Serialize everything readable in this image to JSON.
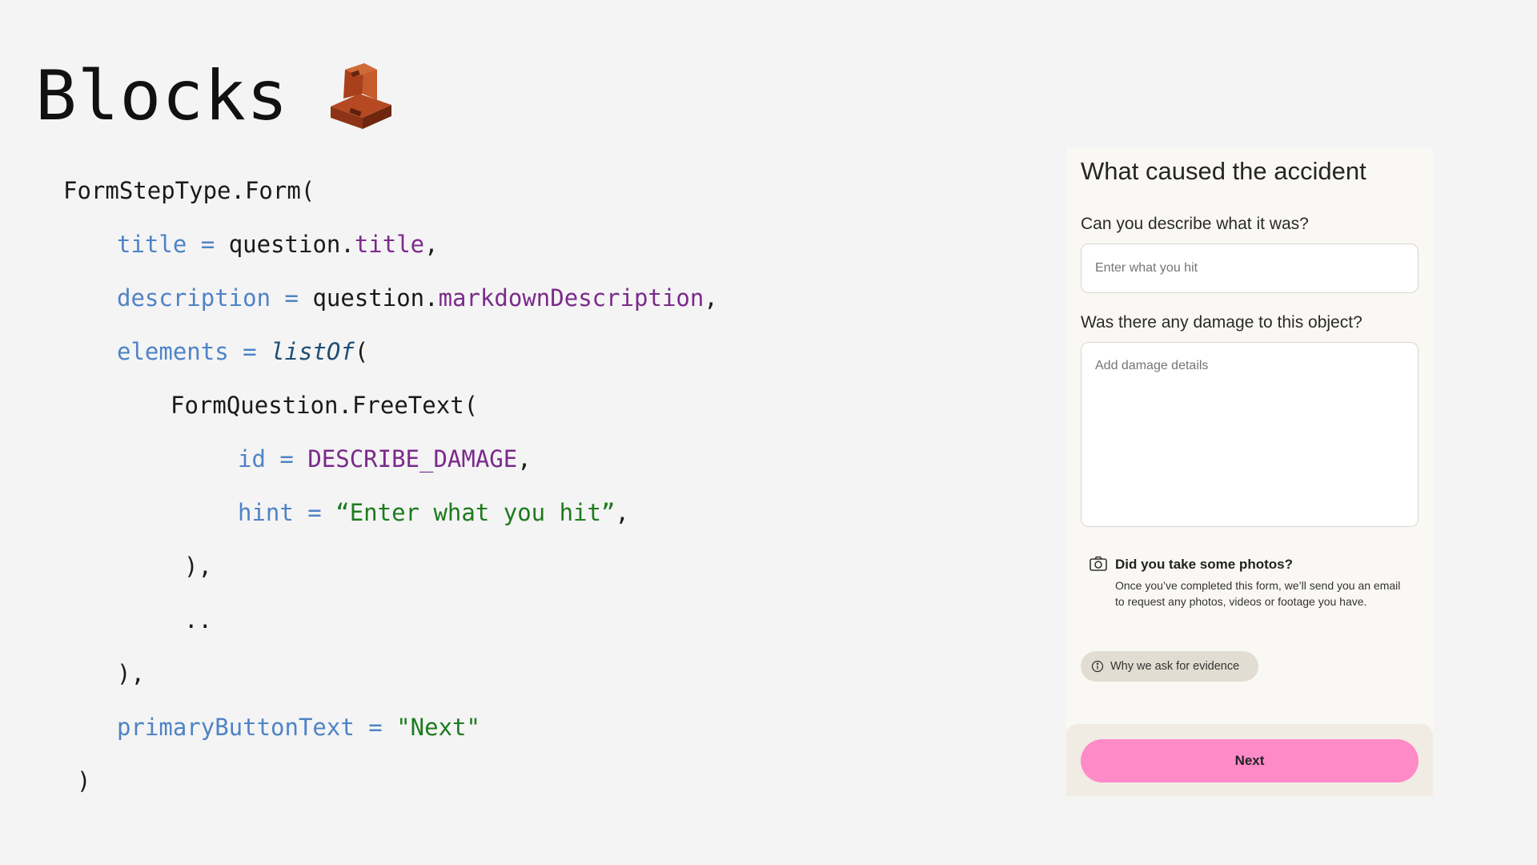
{
  "slide": {
    "title": "Blocks",
    "title_icon": "brick-icon"
  },
  "code": {
    "l1": "FormStepType.Form(",
    "l2_kw": "title",
    "l2_eq": " = ",
    "l2_obj": "question.",
    "l2_prop": "title",
    "l2_end": ",",
    "l3_kw": "description",
    "l3_eq": " = ",
    "l3_obj": "question.",
    "l3_prop": "markdownDescription",
    "l3_end": ",",
    "l4_kw": "elements",
    "l4_eq": " = ",
    "l4_fn": "listOf",
    "l4_end": "(",
    "l5": "FormQuestion.FreeText(",
    "l6_kw": "id",
    "l6_eq": " = ",
    "l6_prop": "DESCRIBE_DAMAGE",
    "l6_end": ",",
    "l7_kw": "hint",
    "l7_eq": " = ",
    "l7_str": "“Enter what you hit”",
    "l7_end": ",",
    "l8": "),",
    "l9": "..",
    "l10": "),",
    "l11_kw": "primaryButtonText",
    "l11_eq": " = ",
    "l11_str": "\"Next\"",
    "l12": ")"
  },
  "form": {
    "title": "What caused the accident",
    "q1_label": "Can you describe what it was?",
    "q1_placeholder": "Enter what you hit",
    "q2_label": "Was there any damage to this object?",
    "q2_placeholder": "Add damage details",
    "info_icon": "camera-icon",
    "info_title": "Did you take some photos?",
    "info_body": "Once you’ve completed this form, we’ll send you an email to request any photos, videos or footage you have.",
    "chip_icon": "info-icon",
    "chip_label": "Why we ask for evidence",
    "next_label": "Next"
  },
  "colors": {
    "background": "#f4f4f4",
    "code_keyword": "#4f83c6",
    "code_property": "#7b2a8c",
    "code_function": "#1f4e73",
    "code_string": "#1d7b1d",
    "panel_bg": "#faf8f4",
    "primary_button": "#ff8ac8",
    "chip_bg": "#e2ddd3"
  }
}
